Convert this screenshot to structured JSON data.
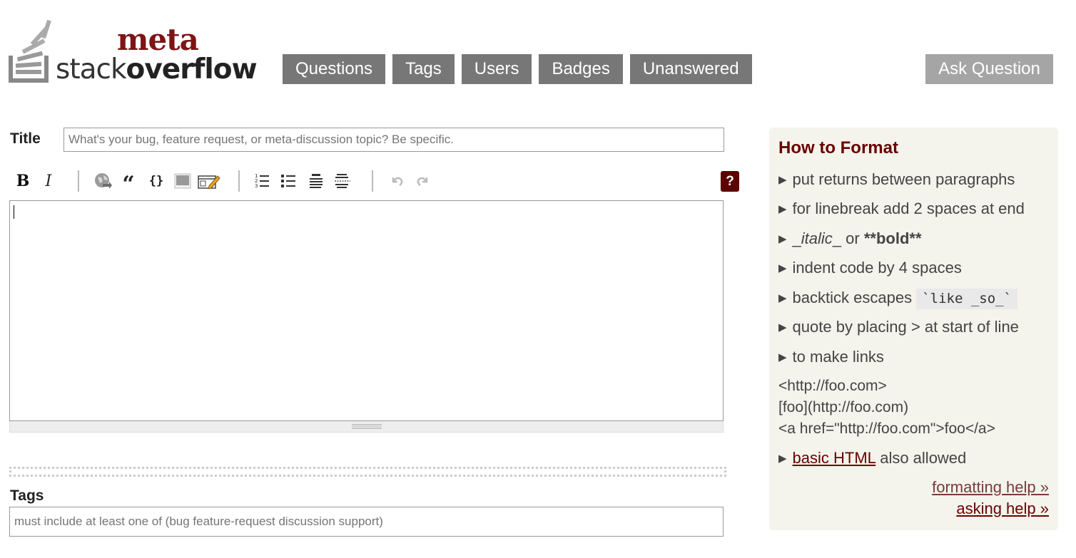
{
  "brand": {
    "meta_text": "meta",
    "stack_text": "stack",
    "overflow_text": "overflow",
    "accent_color": "#7d1416"
  },
  "nav": {
    "items": [
      {
        "label": "Questions"
      },
      {
        "label": "Tags"
      },
      {
        "label": "Users"
      },
      {
        "label": "Badges"
      },
      {
        "label": "Unanswered"
      }
    ],
    "ask_label": "Ask Question"
  },
  "form": {
    "title_label": "Title",
    "title_value": "",
    "title_placeholder": "What's your bug, feature request, or meta-discussion topic? Be specific.",
    "body_value": "",
    "tags_label": "Tags",
    "tags_value": "",
    "tags_placeholder": "must include at least one of (bug feature-request discussion support)"
  },
  "toolbar": {
    "bold": "B",
    "italic": "I",
    "help": "?",
    "buttons": [
      {
        "name": "bold",
        "icon": "bold-icon"
      },
      {
        "name": "italic",
        "icon": "italic-icon"
      },
      {
        "name": "link",
        "icon": "globe-link-icon"
      },
      {
        "name": "blockquote",
        "icon": "quote-icon"
      },
      {
        "name": "code",
        "icon": "code-braces-icon"
      },
      {
        "name": "image",
        "icon": "image-icon"
      },
      {
        "name": "snippet",
        "icon": "snippet-pencil-icon"
      },
      {
        "name": "ordered-list",
        "icon": "ordered-list-icon"
      },
      {
        "name": "bulleted-list",
        "icon": "bulleted-list-icon"
      },
      {
        "name": "heading",
        "icon": "heading-icon"
      },
      {
        "name": "horizontal-rule",
        "icon": "horizontal-rule-icon"
      },
      {
        "name": "undo",
        "icon": "undo-icon"
      },
      {
        "name": "redo",
        "icon": "redo-icon"
      },
      {
        "name": "help",
        "icon": "help-icon"
      }
    ]
  },
  "sidebar": {
    "title": "How to Format",
    "items": [
      {
        "text": "put returns between paragraphs"
      },
      {
        "text": "for linebreak add 2 spaces at end"
      },
      {
        "pre": "_",
        "italic": "italic",
        "mid": "_ or ",
        "bold": "**bold**"
      },
      {
        "text": "indent code by 4 spaces"
      },
      {
        "text": "backtick escapes ",
        "code": "`like _so_`"
      },
      {
        "text": "quote by placing > at start of line"
      },
      {
        "text": "to make links"
      }
    ],
    "link_examples": [
      "<http://foo.com>",
      "[foo](http://foo.com)",
      "<a href=\"http://foo.com\">foo</a>"
    ],
    "html_link": "basic HTML",
    "html_rest": " also allowed",
    "formatting_help": "formatting help »",
    "asking_help": "asking help »",
    "title_color": "#6a0000",
    "background": "#f4f3ec"
  }
}
